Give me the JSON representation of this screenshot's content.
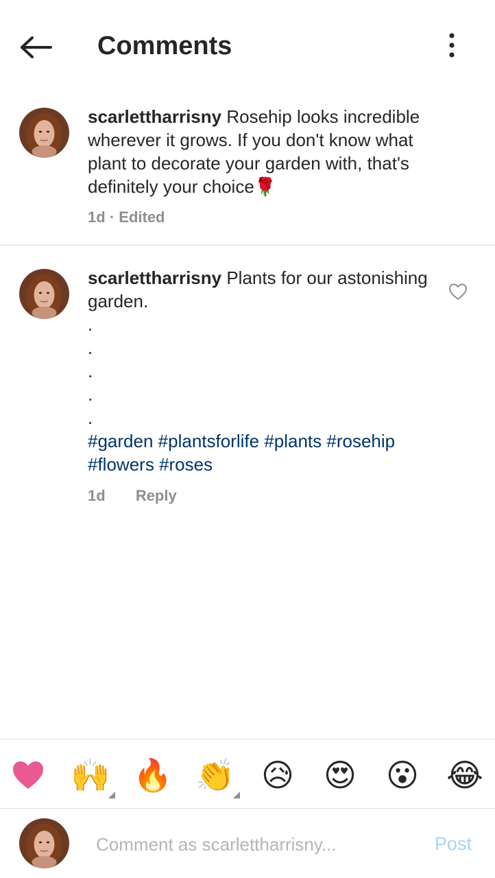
{
  "header": {
    "title": "Comments"
  },
  "comments": [
    {
      "username": "scarlettharrisny",
      "text": " Rosehip looks incredible wherever it grows. If you don't know what plant to decorate your garden with, that's definitely your choice",
      "emoji": "🌹",
      "time": "1d",
      "separator": "·",
      "edited": "Edited"
    },
    {
      "username": "scarlettharrisny",
      "text": " Plants for our astonishing garden.",
      "dots": [
        ".",
        ".",
        ".",
        ".",
        "."
      ],
      "hashtags": [
        "#garden",
        "#plantsforlife",
        "#plants",
        "#rosehip",
        "#flowers",
        "#roses"
      ],
      "time": "1d",
      "reply": "Reply"
    }
  ],
  "emoji_bar": {
    "items": [
      {
        "name": "heart",
        "glyph": "❤️"
      },
      {
        "name": "raising-hands",
        "glyph": "🙌"
      },
      {
        "name": "fire",
        "glyph": "🔥"
      },
      {
        "name": "clapping-hands",
        "glyph": "👏"
      },
      {
        "name": "sad-face",
        "glyph": "😥"
      },
      {
        "name": "heart-eyes",
        "glyph": "😍"
      },
      {
        "name": "surprised-face",
        "glyph": "😮"
      },
      {
        "name": "laughing-face",
        "glyph": "😂"
      }
    ]
  },
  "input": {
    "placeholder": "Comment as scarlettharrisny...",
    "post_label": "Post"
  },
  "colors": {
    "hashtag": "#003569",
    "meta": "#8e8e8e",
    "post_disabled": "#a9d4f5",
    "divider": "#dbdbdb"
  }
}
